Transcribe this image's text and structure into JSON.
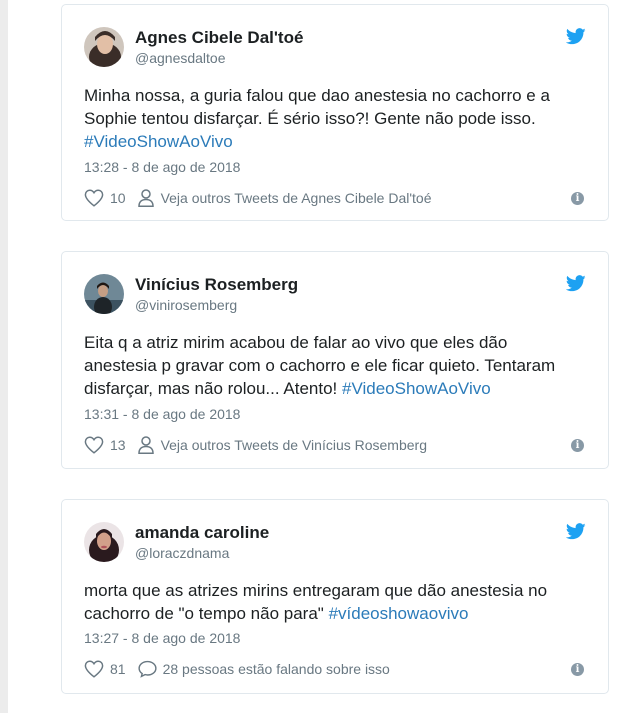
{
  "colors": {
    "accent": "#2b7bb9",
    "twitter_blue": "#1da1f2",
    "muted": "#697882",
    "border": "#e1e8ed"
  },
  "tweets": [
    {
      "name": "Agnes Cibele Dal'toé",
      "handle": "@agnesdaltoe",
      "text_lines": [
        "Minha nossa, a guria falou que dao anestesia no cachorro e a",
        "Sophie tentou disfarçar. É sério isso?! Gente não pode isso."
      ],
      "text_prefix": "",
      "hashtag": "#VideoShowAoVivo",
      "time": "13:28 - 8 de ago de 2018",
      "likes": "10",
      "action_icon": "person-icon",
      "action_text": "Veja outros Tweets de Agnes Cibele Dal'toé"
    },
    {
      "name": "Vinícius Rosemberg",
      "handle": "@vinirosemberg",
      "text_lines": [
        "Eita q a atriz mirim acabou de falar ao vivo que eles dão",
        "anestesia p gravar com o cachorro e ele ficar quieto. Tentaram"
      ],
      "text_prefix": "disfarçar, mas não rolou... Atento! ",
      "hashtag": "#VideoShowAoVivo",
      "time": "13:31 - 8 de ago de 2018",
      "likes": "13",
      "action_icon": "person-icon",
      "action_text": "Veja outros Tweets de Vinícius Rosemberg"
    },
    {
      "name": "amanda caroline",
      "handle": "@loraczdnama",
      "text_lines": [
        "morta que as atrizes mirins entregaram que dão anestesia no"
      ],
      "text_prefix": "cachorro de \"o tempo não para\" ",
      "hashtag": "#vídeoshowaovivo",
      "time": "13:27 - 8 de ago de 2018",
      "likes": "81",
      "action_icon": "speech-bubble-icon",
      "action_text": "28 pessoas estão falando sobre isso"
    }
  ],
  "info_glyph": "i"
}
